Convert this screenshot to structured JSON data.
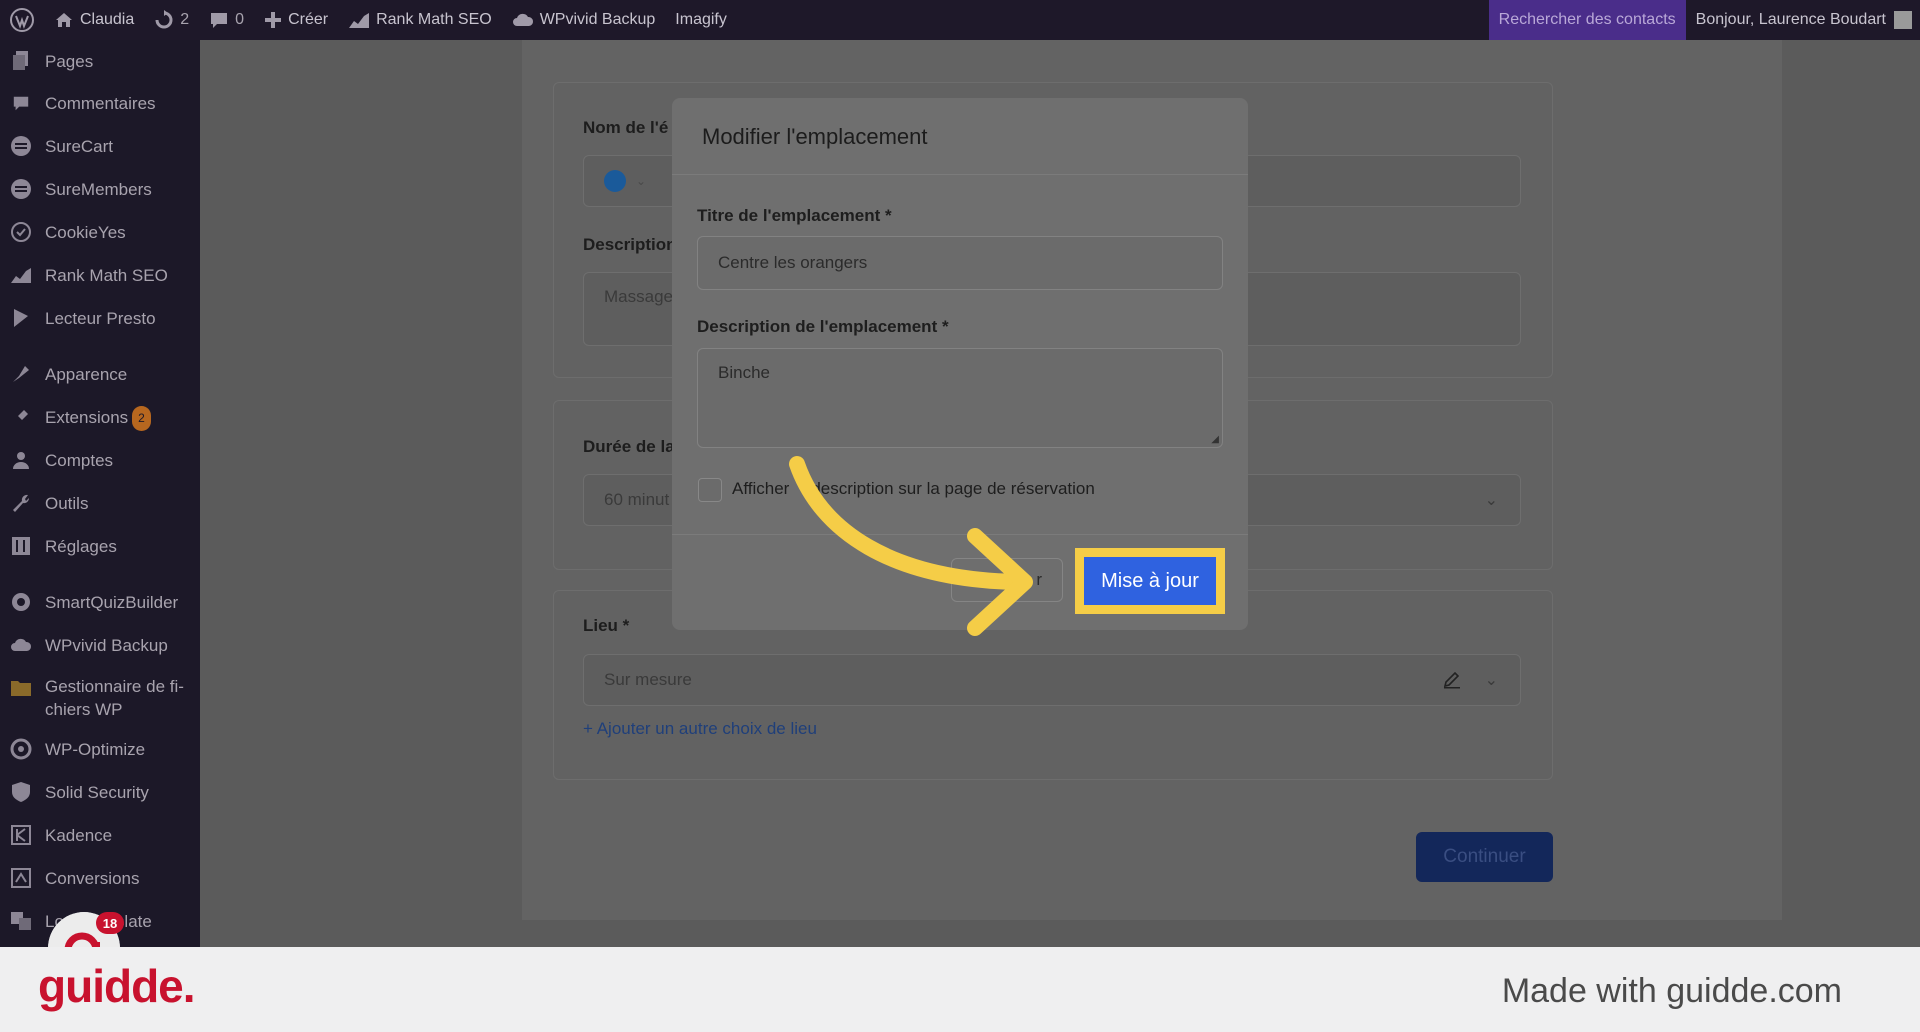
{
  "adminbar": {
    "site_name": "Claudia",
    "updates_count": "2",
    "comments_count": "0",
    "create_label": "Créer",
    "rankmath_label": "Rank Math SEO",
    "wpvivid_label": "WPvivid Backup",
    "imagify_label": "Imagify",
    "contacts_label": "Rechercher des contacts",
    "greeting": "Bonjour, Laurence Boudart"
  },
  "sidebar": {
    "items": [
      {
        "label": "Pages",
        "icon": "pages-icon"
      },
      {
        "label": "Commentaires",
        "icon": "comments-icon"
      },
      {
        "label": "SureCart",
        "icon": "surecart-icon"
      },
      {
        "label": "SureMembers",
        "icon": "suremembers-icon"
      },
      {
        "label": "CookieYes",
        "icon": "cookieyes-icon"
      },
      {
        "label": "Rank Math SEO",
        "icon": "rankmath-icon"
      },
      {
        "label": "Lecteur Presto",
        "icon": "presto-icon"
      },
      {
        "label": "Apparence",
        "icon": "appearance-icon"
      },
      {
        "label": "Extensions",
        "icon": "plugins-icon",
        "badge": "2"
      },
      {
        "label": "Comptes",
        "icon": "users-icon"
      },
      {
        "label": "Outils",
        "icon": "tools-icon"
      },
      {
        "label": "Réglages",
        "icon": "settings-icon"
      },
      {
        "label": "SmartQuizBuilder",
        "icon": "gear-icon"
      },
      {
        "label": "WPvivid Backup",
        "icon": "cloud-icon"
      },
      {
        "label": "Gestionnaire de fi-",
        "label2": "chiers WP",
        "icon": "file-manager-icon"
      },
      {
        "label": "WP-Optimize",
        "icon": "optimize-icon"
      },
      {
        "label": "Solid Security",
        "icon": "shield-icon"
      },
      {
        "label": "Kadence",
        "icon": "kadence-icon"
      },
      {
        "label": "Conversions",
        "icon": "conversions-icon"
      },
      {
        "label": "Lo",
        "label_tail": "slate",
        "icon": "translate-icon"
      }
    ]
  },
  "background_form": {
    "name_label": "Nom de l'é",
    "description_label": "Description",
    "description_value": "Massage",
    "duration_label": "Durée de la",
    "duration_value": "60 minut",
    "location_label": "Lieu *",
    "location_value": "Sur mesure",
    "add_location_link": "+ Ajouter un autre choix de lieu",
    "continue_label": "Continuer",
    "color_dot": "#1a5a9a"
  },
  "modal": {
    "title": "Modifier l'emplacement",
    "title_field_label": "Titre de l'emplacement *",
    "title_field_value": "Centre les orangers",
    "desc_field_label": "Description de l'emplacement *",
    "desc_field_value": "Binche",
    "checkbox_label_a": "Afficher",
    "checkbox_label_b": "description sur la page de réservation",
    "cancel_label": "r",
    "update_label": "Mise à jour",
    "highlight_color": "#f5cd47",
    "primary_color": "#2f62e0"
  },
  "recorder": {
    "badge_count": "18"
  },
  "footer": {
    "brand": "guidde.",
    "made_with": "Made with guidde.com"
  }
}
